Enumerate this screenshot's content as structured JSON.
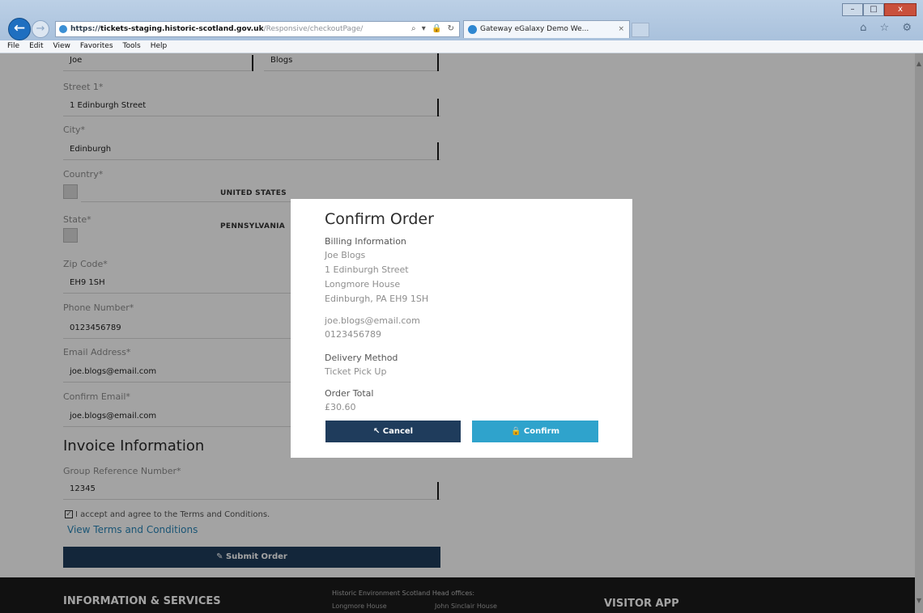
{
  "browser": {
    "url_protocol": "https://",
    "url_host": "tickets-staging.historic-scotland.gov.uk",
    "url_path": "/Responsive/checkoutPage/",
    "addr_controls": "⌕ ▾ 🔒 ↻",
    "tab_title": "Gateway eGalaxy Demo We...",
    "tab_close": "×",
    "back_icon": "←",
    "forward_icon": "→",
    "window_buttons": {
      "minimize": "–",
      "maximize": "□",
      "close": "x"
    },
    "toolbar_icons": "⌂ ☆ ⚙",
    "menu": [
      "File",
      "Edit",
      "View",
      "Favorites",
      "Tools",
      "Help"
    ]
  },
  "form": {
    "first_name": "Joe",
    "last_name": "Blogs",
    "street_label": "Street 1*",
    "street_value": "1 Edinburgh Street",
    "city_label": "City*",
    "city_value": "Edinburgh",
    "country_label": "Country*",
    "country_value": "UNITED STATES",
    "state_label": "State*",
    "state_value": "PENNSYLVANIA",
    "zip_label": "Zip Code*",
    "zip_value": "EH9 1SH",
    "phone_label": "Phone Number*",
    "phone_value": "0123456789",
    "email_label": "Email Address*",
    "email_value": "joe.blogs@email.com",
    "confirm_email_label": "Confirm Email*",
    "confirm_email_value": "joe.blogs@email.com"
  },
  "invoice": {
    "heading": "Invoice Information",
    "group_ref_label": "Group Reference Number*",
    "group_ref_value": "12345",
    "terms_checked": "✓",
    "terms_text": "I accept and agree to the Terms and Conditions.",
    "terms_link": "View Terms and Conditions",
    "submit_label": "✎ Submit Order"
  },
  "footer": {
    "info_heading": "INFORMATION & SERVICES",
    "office_heading": "Historic Environment Scotland Head offices:",
    "office_1": "Longmore House",
    "office_2": "John Sinclair House",
    "app_heading": "VISITOR APP"
  },
  "modal": {
    "title": "Confirm Order",
    "billing_heading": "Billing Information",
    "billing_name": "Joe Blogs",
    "billing_street": "1 Edinburgh Street",
    "billing_house": "Longmore House",
    "billing_city": "Edinburgh, PA EH9 1SH",
    "email": "joe.blogs@email.com",
    "phone": "0123456789",
    "delivery_heading": "Delivery Method",
    "delivery_value": "Ticket Pick Up",
    "total_heading": "Order Total",
    "total_value": "£30.60",
    "cancel_label": "↖ Cancel",
    "confirm_label": "🔒 Confirm"
  },
  "colors": {
    "primary_dark": "#1f3c5c",
    "accent_blue": "#2fa3cc",
    "link_blue": "#2a86b8"
  }
}
